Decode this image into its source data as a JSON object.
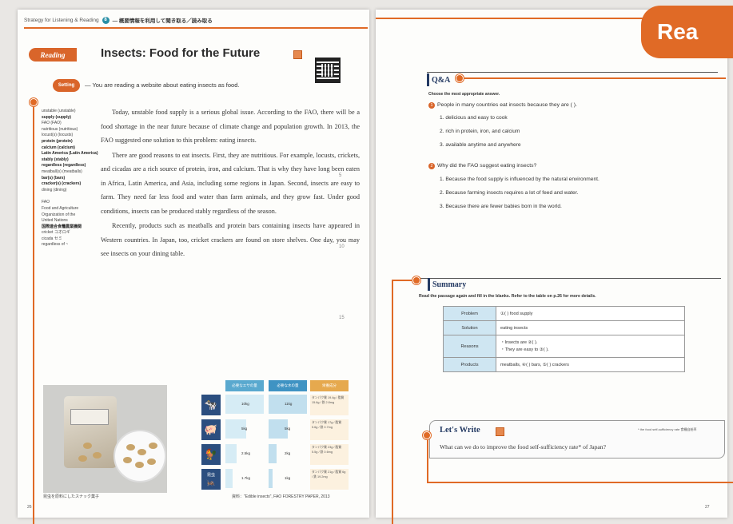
{
  "header": {
    "strategy_label": "Strategy for Listening & Reading",
    "strategy_number": "8",
    "strategy_jp": "— 概要情報を利用して聞き取る／読み取る"
  },
  "reading": {
    "badge": "Reading",
    "title": "Insects: Food for the Future",
    "setting_badge": "Setting",
    "setting_text": "— You are reading a website about eating insects as food."
  },
  "glossary": {
    "items": [
      "unstable (unstable)",
      "supply (supply)",
      "FAO (FAO)",
      "nutritious (nutritious)",
      "locust(s) (locusts)",
      "protein (protein)",
      "calcium (calcium)",
      "Latin America (Latin America)",
      "stably (stably)",
      "regardless (regardless)",
      "meatball(s) (meatballs)",
      "bar(s) (bars)",
      "cracker(s) (crackers)",
      "dining (dining)"
    ],
    "notes": [
      "FAO",
      "Food and Agriculture",
      "Organization of the",
      "United Nations",
      "国際連合食糧農業機関",
      "cricket コオロギ",
      "cicada セミ",
      "regardless of ~"
    ]
  },
  "passage": {
    "p1": "Today, unstable food supply is a serious global issue. According to the FAO, there will be a food shortage in the near future because of climate change and population growth. In 2013, the FAO suggested one solution to this problem: eating insects.",
    "p2": "There are good reasons to eat insects. First, they are nutritious. For example, locusts, crickets, and cicadas are a rich source of protein, iron, and calcium. That is why they have long been eaten in Africa, Latin America, and Asia, including some regions in Japan. Second, insects are easy to farm. They need far less food and water than farm animals, and they grow fast. Under good conditions, insects can be produced stably regardless of the season.",
    "p3": "Recently, products such as meatballs and protein bars containing insects have appeared in Western countries. In Japan, too, cricket crackers are found on store shelves. One day, you may see insects on your dining table.",
    "line_marks": [
      "5",
      "10",
      "15"
    ]
  },
  "figure": {
    "photo_caption": "昆虫を原料にしたスナック菓子",
    "table_headers": [
      "必要なエサの量",
      "必要な水の量",
      "栄養成分"
    ],
    "rows": [
      {
        "icon": "cow-icon",
        "glyph": "🐄",
        "feed": "10kg",
        "water": "11kg",
        "nut": "タンパク質 19.4g / 脂質 15.6g / 鉄 2.8mg"
      },
      {
        "icon": "pig-icon",
        "glyph": "🐖",
        "feed": "5kg",
        "water": "5kg",
        "nut": "タンパク質 17g / 脂質 5.6g / 鉄 0.7mg"
      },
      {
        "icon": "chicken-icon",
        "glyph": "🐓",
        "feed": "2.5kg",
        "water": "2kg",
        "nut": "タンパク質 23g / 脂質 5.5g / 鉄 0.6mg"
      },
      {
        "icon": "cricket-icon",
        "glyph": "🦗",
        "feed": "1.7kg",
        "water": "1kg",
        "nut": "タンパク質 21g / 脂質 6g / 鉄 19.2mg"
      }
    ],
    "row_glyphs": [
      "🐄",
      "🐖",
      "🐓",
      "🦗"
    ],
    "row_labels": [
      "",
      "",
      "",
      "昆虫"
    ],
    "source": "資料：\"Edible insects\", FAO FORESTRY PAPER, 2013"
  },
  "pages": {
    "left": "26",
    "right": "27"
  },
  "tab": {
    "label": "Rea"
  },
  "qa": {
    "heading": "Q&A",
    "instruction": "Choose the most appropriate answer.",
    "q1": {
      "num": "1",
      "text": "People in many countries eat insects because they are (                    )."
    },
    "q1_options": [
      "1. delicious and easy to cook",
      "2. rich in protein, iron, and calcium",
      "3. available anytime and anywhere"
    ],
    "q2": {
      "num": "2",
      "text": "Why did the FAO suggest eating insects?"
    },
    "q2_options": [
      "1. Because the food supply is influenced by the natural environment.",
      "2. Because farming insects requires a lot of feed and water.",
      "3. Because there are fewer babies born in the world."
    ]
  },
  "summary": {
    "heading": "Summary",
    "instruction": "Read the passage again and fill in the blanks. Refer to the table on p.26 for more details.",
    "rows": [
      {
        "label": "Problem",
        "cell": "①(                    ) food supply"
      },
      {
        "label": "Solution",
        "cell": "eating insects"
      },
      {
        "label": "Reasons",
        "cell": "・Insects are ②(                    ).\n・They are easy to ③(                    )."
      },
      {
        "label": "Products",
        "cell": "meatballs, ④(                    ) bars, ⑤(                    ) crackers"
      }
    ]
  },
  "lets_write": {
    "title": "Let's Write",
    "note": "* the food self-sufficiency rate 食糧自給率",
    "question": "What can we do to improve the food self-sufficiency rate* of Japan?"
  },
  "colors": {
    "accent": "#e06a26",
    "navy": "#243a63",
    "table_fill": "#cfe6f2"
  }
}
